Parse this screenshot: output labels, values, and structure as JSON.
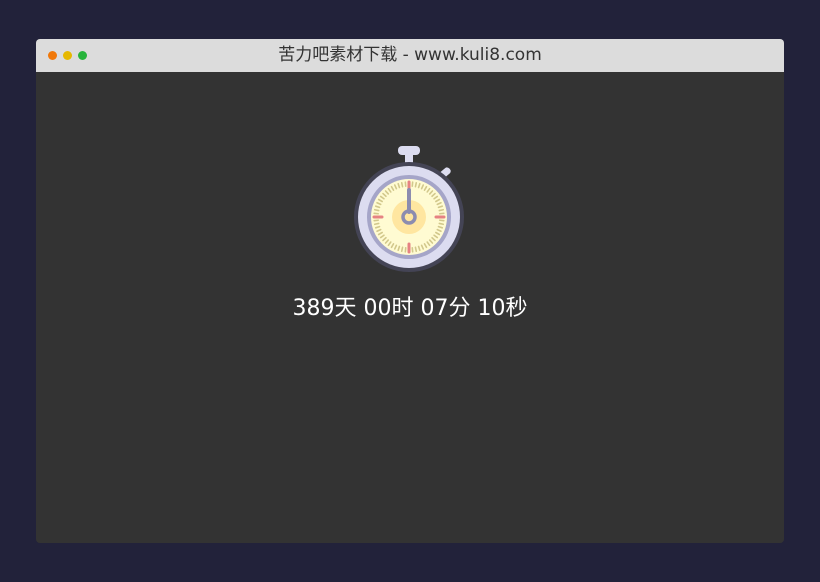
{
  "window": {
    "title": "苦力吧素材下载 - www.kuli8.com",
    "controls": [
      {
        "name": "close",
        "color": "#f0780a"
      },
      {
        "name": "minimize",
        "color": "#e6b800"
      },
      {
        "name": "maximize",
        "color": "#28b43c"
      }
    ]
  },
  "icon": {
    "name": "stopwatch-icon",
    "colors": {
      "body": "#dcdcf0",
      "body_shade": "#a5a5c8",
      "face": "#fffbd2",
      "center_glow": "#ffe6a0",
      "ticks": "#d2c88c",
      "major_ticks": "#e68282",
      "hand": "#8c8caf"
    }
  },
  "countdown": {
    "text": "389天 00时 07分 10秒",
    "days": 389,
    "hours": 0,
    "minutes": 7,
    "seconds": 10
  }
}
